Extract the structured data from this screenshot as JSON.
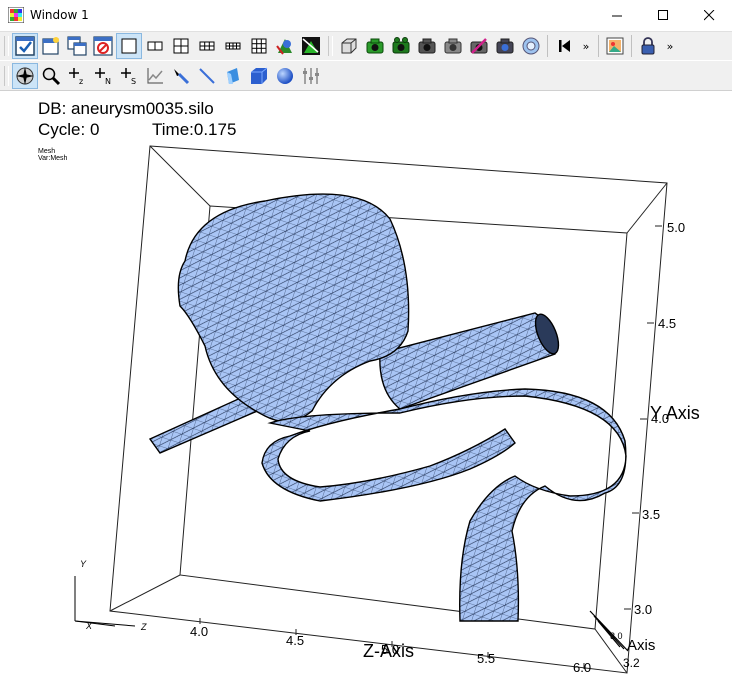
{
  "window": {
    "title": "Window 1"
  },
  "plot": {
    "db_label": "DB: aneurysm0035.silo",
    "cycle_label": "Cycle: 0",
    "time_label": "Time:0.175",
    "legend_plot": "Mesh",
    "legend_var": "Var:Mesh",
    "z_axis_title": "Z-Axis",
    "y_axis_title": "Y Axis",
    "x_axis_title": "Axis",
    "z_ticks": [
      "4.0",
      "4.5",
      "5.0",
      "5.5",
      "6.0"
    ],
    "y_ticks": [
      "3.0",
      "3.5",
      "4.0",
      "4.5",
      "5.0"
    ],
    "x_tick": "3.2",
    "x_tick_partial": "3.0",
    "triad": {
      "y": "Y",
      "x": "X",
      "z": "Z"
    }
  },
  "colors": {
    "mesh_fill": "#a9c5f5",
    "mesh_line": "#000000",
    "toolbar_bg": "#f0f0f0"
  }
}
